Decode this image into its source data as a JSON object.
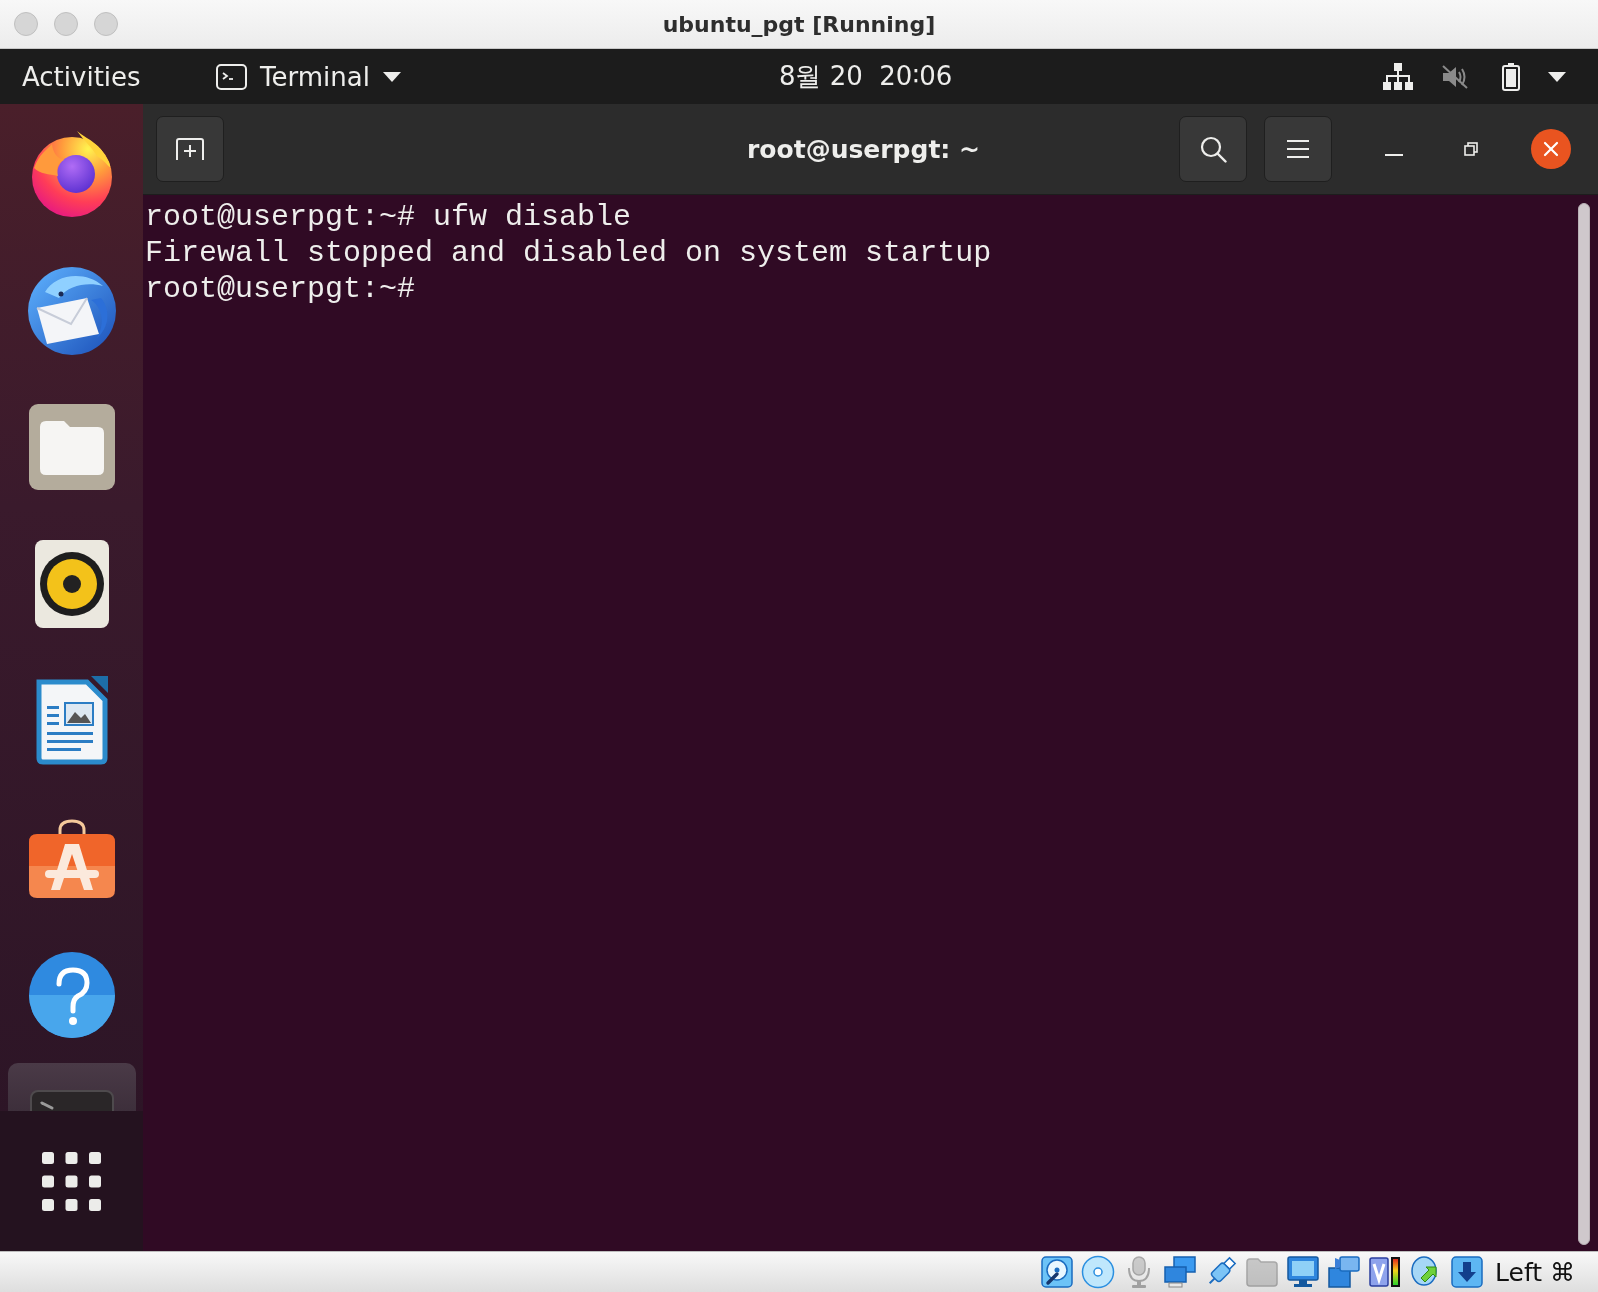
{
  "window": {
    "title": "ubuntu_pgt [Running]"
  },
  "top_bar": {
    "activities": "Activities",
    "app_menu": "Terminal",
    "clock": "8월 20  20∶06"
  },
  "dock": {
    "items": [
      {
        "kind": "browser",
        "active": false
      },
      {
        "kind": "mail",
        "active": false
      },
      {
        "kind": "files",
        "active": false
      },
      {
        "kind": "music",
        "active": false
      },
      {
        "kind": "writer",
        "active": false
      },
      {
        "kind": "store",
        "active": false
      },
      {
        "kind": "help",
        "active": false
      },
      {
        "kind": "terminal",
        "active": true
      }
    ]
  },
  "terminal": {
    "title": "root@userpgt: ~",
    "lines": [
      "root@userpgt:~# ufw disable",
      "Firewall stopped and disabled on system startup",
      "root@userpgt:~#"
    ]
  },
  "status_bar": {
    "devices": [
      {
        "kind": "hard-disk",
        "enabled": true
      },
      {
        "kind": "optical-disc",
        "enabled": true
      },
      {
        "kind": "audio",
        "enabled": false
      },
      {
        "kind": "network",
        "enabled": true
      },
      {
        "kind": "usb",
        "enabled": true
      },
      {
        "kind": "shared-folders",
        "enabled": false
      },
      {
        "kind": "display",
        "enabled": true
      },
      {
        "kind": "recording",
        "enabled": true
      },
      {
        "kind": "cpu",
        "enabled": true
      },
      {
        "kind": "mouse",
        "enabled": true
      },
      {
        "kind": "keyboard",
        "enabled": true
      }
    ],
    "host_key": "Left ⌘"
  }
}
